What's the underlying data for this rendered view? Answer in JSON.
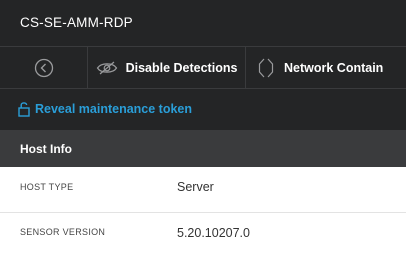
{
  "header": {
    "host_name": "CS-SE-AMM-RDP"
  },
  "toolbar": {
    "back_icon": "circle-chevron-left-icon",
    "disable_detections_label": "Disable Detections",
    "disable_detections_icon": "eye-slash-icon",
    "network_contain_label": "Network Contain",
    "network_contain_icon": "network-contain-icon"
  },
  "maintenance": {
    "reveal_token_label": "Reveal maintenance token",
    "icon": "unlock-icon"
  },
  "host_info": {
    "title": "Host Info",
    "rows": [
      {
        "label": "HOST TYPE",
        "value": "Server"
      },
      {
        "label": "SENSOR VERSION",
        "value": "5.20.10207.0"
      }
    ]
  },
  "colors": {
    "header_bg": "#242526",
    "section_bg": "#3a3b3d",
    "link": "#2a9ed8"
  }
}
